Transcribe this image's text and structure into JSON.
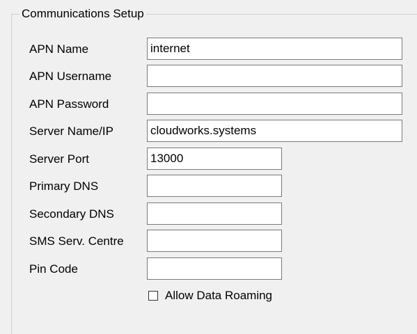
{
  "group": {
    "title": "Communications Setup"
  },
  "fields": {
    "apn_name": {
      "label": "APN Name",
      "value": "internet"
    },
    "apn_username": {
      "label": "APN Username",
      "value": ""
    },
    "apn_password": {
      "label": "APN Password",
      "value": ""
    },
    "server_name": {
      "label": "Server Name/IP",
      "value": "cloudworks.systems"
    },
    "server_port": {
      "label": "Server Port",
      "value": "13000"
    },
    "primary_dns": {
      "label": "Primary DNS",
      "value": ""
    },
    "secondary_dns": {
      "label": "Secondary DNS",
      "value": ""
    },
    "sms_centre": {
      "label": "SMS Serv. Centre",
      "value": ""
    },
    "pin_code": {
      "label": "Pin Code",
      "value": ""
    }
  },
  "roaming": {
    "label": "Allow Data Roaming",
    "checked": false
  }
}
